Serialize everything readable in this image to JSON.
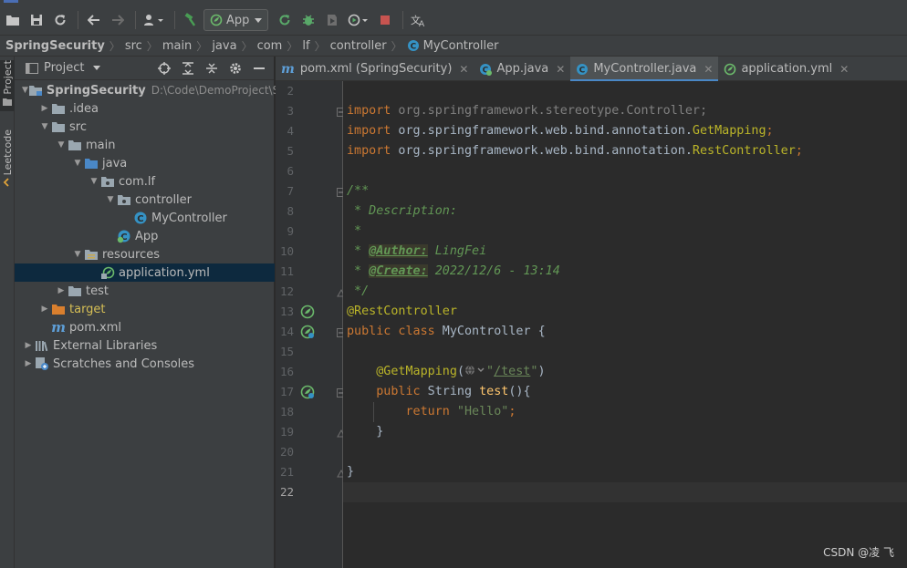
{
  "toolbar": {
    "run_config_label": "App"
  },
  "breadcrumb": [
    "SpringSecurity",
    "src",
    "main",
    "java",
    "com",
    "lf",
    "controller",
    "MyController"
  ],
  "side_tabs": {
    "project": "Project",
    "leetcode": "Leetcode"
  },
  "project_panel": {
    "title": "Project",
    "tree": [
      {
        "label": "SpringSecurity",
        "path": "D:\\Code\\DemoProject\\Sp",
        "depth": 0,
        "expanded": true,
        "icon": "module-folder-icon"
      },
      {
        "label": ".idea",
        "depth": 1,
        "expanded": false,
        "icon": "folder-icon"
      },
      {
        "label": "src",
        "depth": 1,
        "expanded": true,
        "icon": "folder-icon"
      },
      {
        "label": "main",
        "depth": 2,
        "expanded": true,
        "icon": "folder-icon"
      },
      {
        "label": "java",
        "depth": 3,
        "expanded": true,
        "icon": "source-folder-icon"
      },
      {
        "label": "com.lf",
        "depth": 4,
        "expanded": true,
        "icon": "package-icon"
      },
      {
        "label": "controller",
        "depth": 5,
        "expanded": true,
        "icon": "package-icon"
      },
      {
        "label": "MyController",
        "depth": 6,
        "icon": "class-icon"
      },
      {
        "label": "App",
        "depth": 5,
        "icon": "spring-class-icon"
      },
      {
        "label": "resources",
        "depth": 3,
        "expanded": true,
        "icon": "resources-folder-icon"
      },
      {
        "label": "application.yml",
        "depth": 4,
        "icon": "spring-yml-icon",
        "selected": true
      },
      {
        "label": "test",
        "depth": 2,
        "expanded": false,
        "icon": "folder-icon"
      },
      {
        "label": "target",
        "depth": 1,
        "expanded": false,
        "icon": "excluded-folder-icon"
      },
      {
        "label": "pom.xml",
        "depth": 1,
        "icon": "maven-icon"
      },
      {
        "label": "External Libraries",
        "depth": 0,
        "expanded": false,
        "icon": "libraries-icon"
      },
      {
        "label": "Scratches and Consoles",
        "depth": 0,
        "expanded": false,
        "icon": "scratches-icon"
      }
    ]
  },
  "tabs": [
    {
      "label": "pom.xml (SpringSecurity)",
      "icon": "maven-icon",
      "active": false
    },
    {
      "label": "App.java",
      "icon": "spring-class-icon",
      "active": false
    },
    {
      "label": "MyController.java",
      "icon": "class-icon",
      "active": true
    },
    {
      "label": "application.yml",
      "icon": "spring-yml-icon",
      "active": false
    }
  ],
  "editor": {
    "line_numbers": [
      "2",
      "3",
      "4",
      "5",
      "6",
      "7",
      "8",
      "9",
      "10",
      "11",
      "12",
      "13",
      "14",
      "15",
      "16",
      "17",
      "18",
      "19",
      "20",
      "21",
      "22"
    ],
    "current_line": "22",
    "code": {
      "l3_kw": "import",
      "l3_rest": " org.springframework.stereotype.Controller;",
      "l4_kw": "import",
      "l4_pkg": " org.springframework.web.bind.annotation.",
      "l4_cls": "GetMapping",
      "l4_end": ";",
      "l5_kw": "import",
      "l5_pkg": " org.springframework.web.bind.annotation.",
      "l5_cls": "RestController",
      "l5_end": ";",
      "l7": "/**",
      "l8": " * Description:",
      "l9": " *",
      "l10_pre": " * ",
      "l10_tag": "@Author:",
      "l10_val": " LingFei",
      "l11_pre": " * ",
      "l11_tag": "@Create:",
      "l11_val": " 2022/12/6 - 13:14",
      "l12": " */",
      "l13": "@RestController",
      "l14_kw": "public class",
      "l14_name": " MyController {",
      "l16_pre": "    ",
      "l16_ann": "@GetMapping",
      "l16_open": "(",
      "l16_url_q1": "\"",
      "l16_url": "/test",
      "l16_url_q2": "\"",
      "l16_close": ")",
      "l17_pre": "    ",
      "l17_kw": "public",
      "l17_type": " String ",
      "l17_fn": "test",
      "l17_end": "(){",
      "l18_pre": "        ",
      "l18_kw": "return",
      "l18_str": " \"Hello\"",
      "l18_end": ";",
      "l19": "    }",
      "l21": "}"
    }
  },
  "watermark": "CSDN @凌 飞",
  "colors": {
    "background": "#2b2b2b",
    "panel": "#3c3f41",
    "selection": "#0d293e",
    "accent": "#4a88c7",
    "keyword": "#cc7832",
    "comment": "#629755",
    "annotation": "#bbb529",
    "string": "#6a8759"
  }
}
